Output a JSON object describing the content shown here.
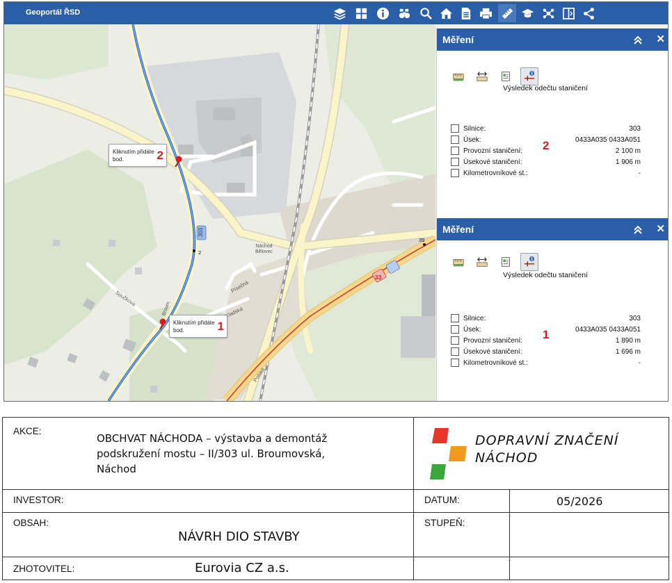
{
  "app": {
    "title": "Geoportál ŘSD"
  },
  "toolbar": {
    "icons": [
      "layers-icon",
      "grid-icon",
      "info-icon",
      "binoculars-icon",
      "search-icon",
      "home-icon",
      "document-icon",
      "print-icon",
      "ruler-icon",
      "graduation-cap-icon",
      "network-icon",
      "split-view-icon",
      "share-icon"
    ],
    "active": "ruler-icon"
  },
  "map": {
    "road_label_303": "303",
    "road_label_33": "33",
    "street_souckova": "Součkova",
    "street_pisecna": "Písečná",
    "street_kladska": "Kladská",
    "street_polska": "Polská",
    "street_broum": "Broum.",
    "station_name": "Náchod\nBělovec",
    "km_2": "2",
    "km_39": "39",
    "callout_text": "Kliknutím přidáte bod.",
    "callout_1_num": "1",
    "callout_2_num": "2"
  },
  "panels": [
    {
      "title": "Měření",
      "result_title": "Výsledek odečtu staničení",
      "marker": "2",
      "rows": [
        {
          "label": "Silnice:",
          "value": "303"
        },
        {
          "label": "Úsek:",
          "value": "0433A035 0433A051"
        },
        {
          "label": "Provozní staničení:",
          "value": "2 100 m"
        },
        {
          "label": "Úsekové staničení:",
          "value": "1 906 m"
        },
        {
          "label": "Kilometrovníkové st.:",
          "value": "-"
        }
      ]
    },
    {
      "title": "Měření",
      "result_title": "Výsledek odečtu staničení",
      "marker": "1",
      "rows": [
        {
          "label": "Silnice:",
          "value": "303"
        },
        {
          "label": "Úsek:",
          "value": "0433A035 0433A051"
        },
        {
          "label": "Provozní staničení:",
          "value": "1 890 m"
        },
        {
          "label": "Úsekové staničení:",
          "value": "1 696 m"
        },
        {
          "label": "Kilometrovníkové st.:",
          "value": "-"
        }
      ]
    }
  ],
  "titleblock": {
    "akce_label": "AKCE:",
    "akce_line1": "OBCHVAT NÁCHODA – výstavba a demontáž",
    "akce_line2": "podskružení mostu – II/303 ul. Broumovská,",
    "akce_line3": "Náchod",
    "logo_line1": "DOPRAVNÍ ZNAČENÍ",
    "logo_line2": "NÁCHOD",
    "logo_colors": {
      "red": "#e8342a",
      "orange": "#f39a1e",
      "green": "#3aa63b"
    },
    "investor_label": "INVESTOR:",
    "datum_label": "DATUM:",
    "datum_value": "05/2026",
    "obsah_label": "OBSAH:",
    "obsah_value": "NÁVRH DIO STAVBY",
    "stupen_label": "STUPEŇ:",
    "zhotovitel_label": "ZHOTOVITEL:",
    "zhotovitel_value": "Eurovia CZ a.s."
  },
  "colors": {
    "header_blue": "#2a5fa8",
    "route_blue": "#2f6fd0",
    "road_red": "#d23a2c",
    "marker_red": "#d61e1e"
  }
}
